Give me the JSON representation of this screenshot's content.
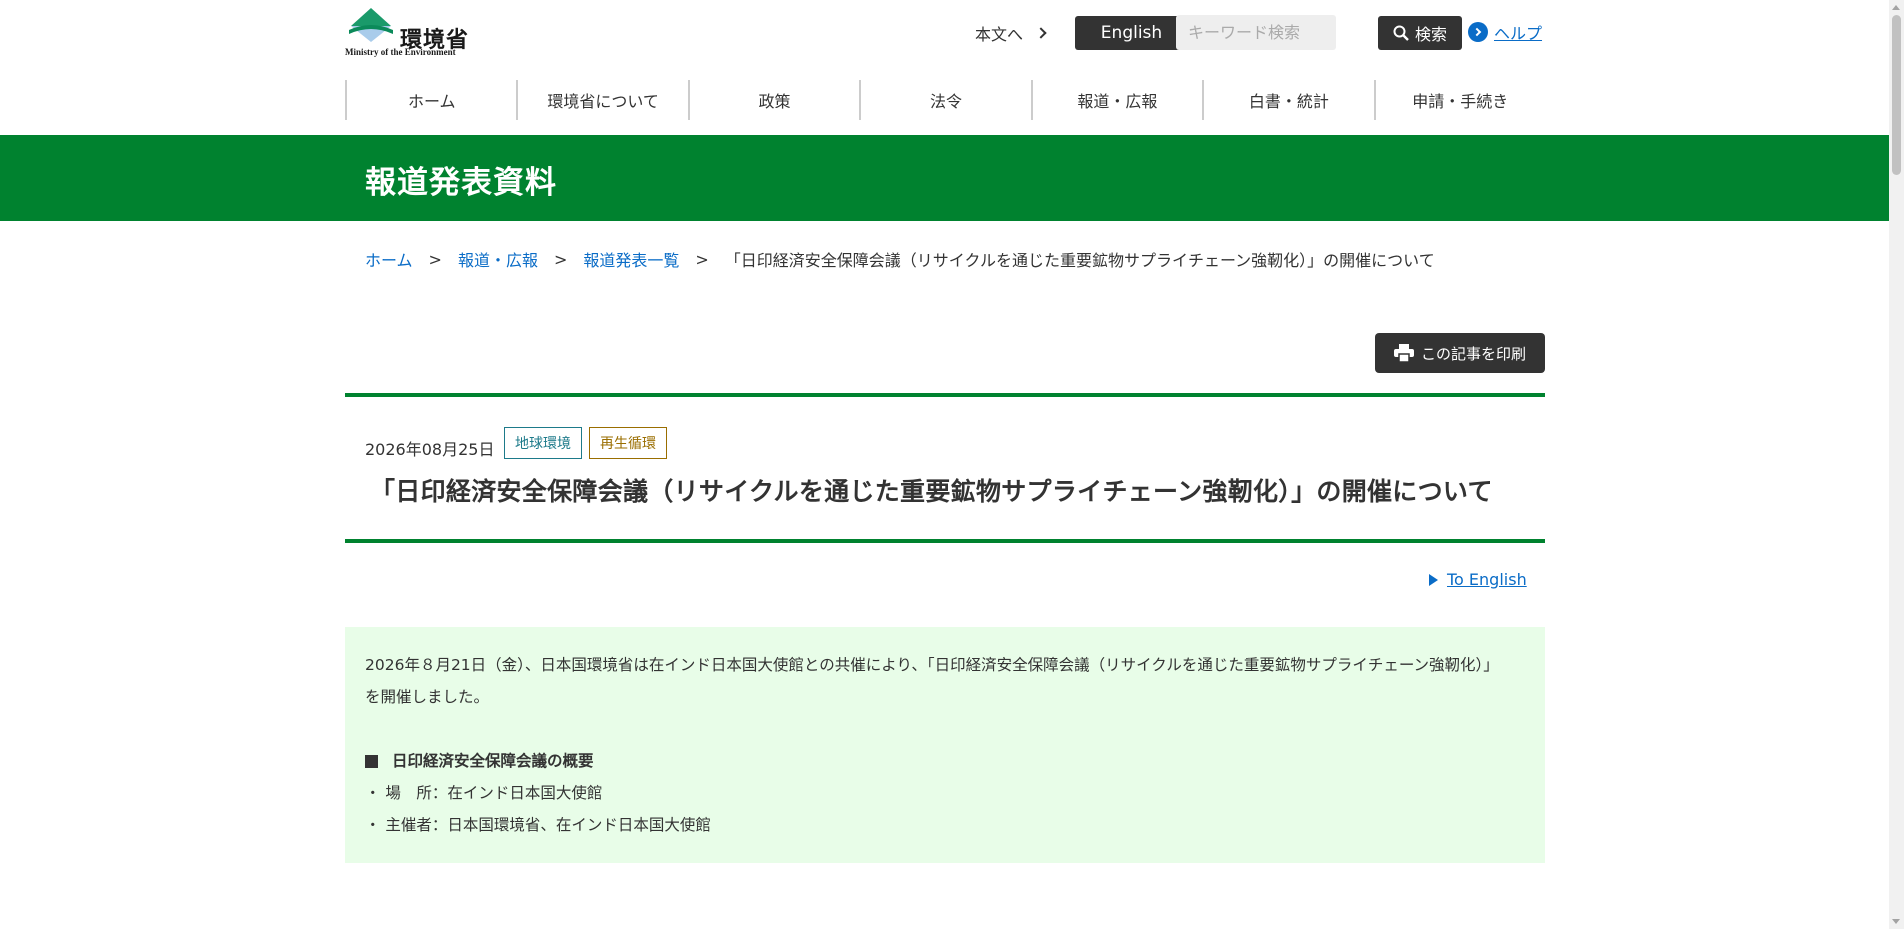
{
  "header": {
    "logo_text": "環境省",
    "logo_subtext": "Ministry of the Environment",
    "skip_link": "本文へ",
    "english_button": "English",
    "search_placeholder": "キーワード検索",
    "search_button": "検索",
    "help_link": "ヘルプ"
  },
  "nav": {
    "items": [
      "ホーム",
      "環境省について",
      "政策",
      "法令",
      "報道・広報",
      "白書・統計",
      "申請・手続き"
    ]
  },
  "banner": {
    "title": "報道発表資料"
  },
  "breadcrumb": {
    "items": [
      "ホーム",
      "報道・広報",
      "報道発表一覧"
    ],
    "separator": ">",
    "current": "「日印経済安全保障会議（リサイクルを通じた重要鉱物サプライチェーン強靭化）」の開催について"
  },
  "print_button": "この記事を印刷",
  "article": {
    "date": "2026年08月25日",
    "tags": [
      "地球環境",
      "再生循環"
    ],
    "title": "「日印経済安全保障会議（リサイクルを通じた重要鉱物サプライチェーン強靭化）」の開催について",
    "to_english": "To English"
  },
  "summary": {
    "lead_line1": "2026年８月21日（金）、日本国環境省は在インド日本国大使館との共催により、「日印経済安全保障会議（リサイクルを通じた重要鉱物サプライチェーン強靭化）」",
    "lead_line2": "を開催しました。",
    "heading": "日印経済安全保障会議の概要",
    "bullets": [
      "・ 場　所：在インド日本国大使館",
      "・ 主催者：日本国環境省、在インド日本国大使館"
    ]
  },
  "colors": {
    "brand_green": "#00822f",
    "link_blue": "#0a6cc7",
    "dark_button": "#333333",
    "summary_bg": "#e8fde8",
    "tag_env": "#1d7a8a",
    "tag_recycle": "#9a6e00"
  },
  "icons": [
    "logo-icon",
    "chevron-right-icon",
    "search-icon",
    "help-chevron-icon",
    "printer-icon",
    "play-triangle-icon",
    "square-bullet-icon"
  ]
}
